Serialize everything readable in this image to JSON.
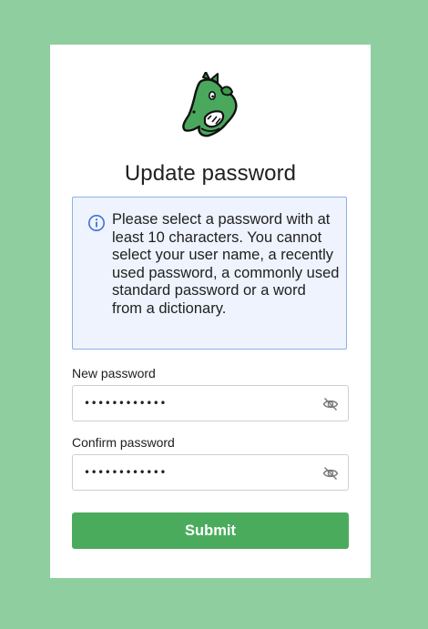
{
  "page": {
    "background_color": "#8fce9f",
    "card_color": "#ffffff"
  },
  "logo": {
    "icon": "green-dragon-logo-icon"
  },
  "title": "Update password",
  "info": {
    "icon": "info-icon",
    "text": "Please select a password with at least 10 characters. You cannot select your user name, a recently used password, a commonly used standard password or a word from a dictionary."
  },
  "fields": {
    "new_password": {
      "label": "New password",
      "value": "••••••••••••",
      "toggle_icon": "eye-slash-icon"
    },
    "confirm_password": {
      "label": "Confirm password",
      "value": "••••••••••••",
      "toggle_icon": "eye-slash-icon"
    }
  },
  "submit": {
    "label": "Submit",
    "color": "#4bab5d"
  }
}
